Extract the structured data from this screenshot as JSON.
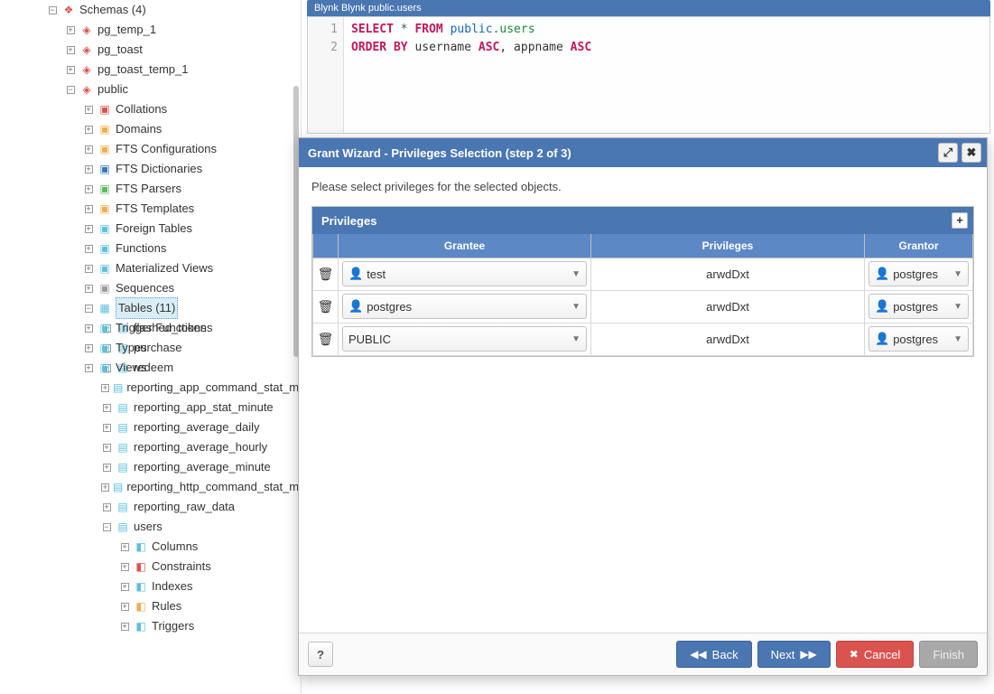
{
  "tree": {
    "root": {
      "label": "Schemas (4)"
    },
    "schema_children": [
      {
        "label": "pg_temp_1"
      },
      {
        "label": "pg_toast"
      },
      {
        "label": "pg_toast_temp_1"
      },
      {
        "label": "public"
      }
    ],
    "public_children": [
      {
        "label": "Collations"
      },
      {
        "label": "Domains"
      },
      {
        "label": "FTS Configurations"
      },
      {
        "label": "FTS Dictionaries"
      },
      {
        "label": "FTS Parsers"
      },
      {
        "label": "FTS Templates"
      },
      {
        "label": "Foreign Tables"
      },
      {
        "label": "Functions"
      },
      {
        "label": "Materialized Views"
      },
      {
        "label": "Sequences"
      }
    ],
    "tables_label": "Tables (11)",
    "tables": [
      "flashed_tokens",
      "purchase",
      "redeem",
      "reporting_app_command_stat_minute",
      "reporting_app_stat_minute",
      "reporting_average_daily",
      "reporting_average_hourly",
      "reporting_average_minute",
      "reporting_http_command_stat_minute",
      "reporting_raw_data",
      "users"
    ],
    "users_children": [
      "Columns",
      "Constraints",
      "Indexes",
      "Rules",
      "Triggers"
    ],
    "after_tables": [
      "Trigger Functions",
      "Types",
      "Views"
    ]
  },
  "sql": {
    "tab": "Blynk Blynk public.users",
    "line1": {
      "kw1": "SELECT",
      "star": "*",
      "kw2": "FROM",
      "schema": "public",
      "dot": ".",
      "table": "users"
    },
    "line2": {
      "kw1": "ORDER BY",
      "col1": "username",
      "asc1": "ASC",
      "comma": ", ",
      "col2": "appname",
      "asc2": "ASC"
    }
  },
  "dialog": {
    "title": "Grant Wizard - Privileges Selection (step 2 of 3)",
    "instruction": "Please select privileges for the selected objects.",
    "panel_title": "Privileges",
    "columns": {
      "grantee": "Grantee",
      "privileges": "Privileges",
      "grantor": "Grantor"
    },
    "rows": [
      {
        "grantee": "test",
        "privileges": "arwdDxt",
        "grantor": "postgres"
      },
      {
        "grantee": "postgres",
        "privileges": "arwdDxt",
        "grantor": "postgres"
      },
      {
        "grantee": "PUBLIC",
        "privileges": "arwdDxt",
        "grantor": "postgres"
      }
    ],
    "buttons": {
      "help": "?",
      "back": "Back",
      "next": "Next",
      "cancel": "Cancel",
      "finish": "Finish"
    }
  }
}
